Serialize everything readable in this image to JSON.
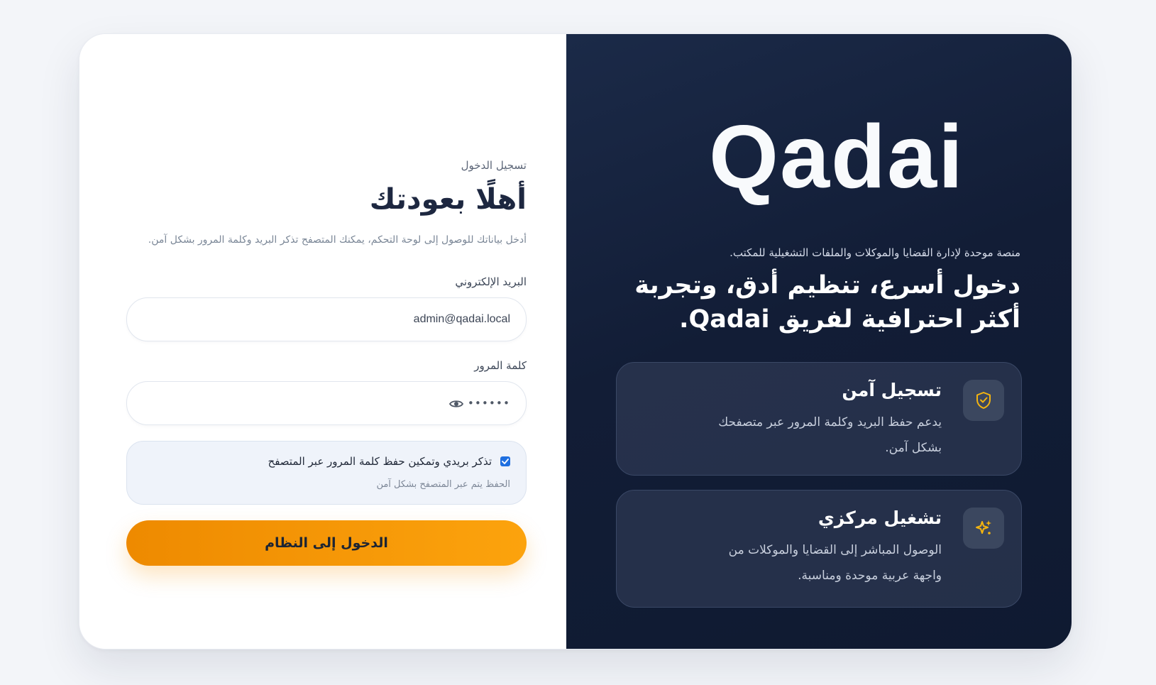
{
  "login": {
    "eyebrow": "تسجيل الدخول",
    "headline": "أهلًا بعودتك",
    "subline": "أدخل بياناتك للوصول إلى لوحة التحكم، يمكنك المتصفح تذكر البريد وكلمة المرور بشكل آمن.",
    "email_label": "البريد الإلكتروني",
    "email_value": "admin@qadai.local",
    "password_label": "كلمة المرور",
    "password_mask": "••••••",
    "remember_checked": true,
    "remember_label": "تذكر بريدي وتمكين حفظ كلمة المرور عبر المتصفح",
    "remember_hint": "الحفظ يتم عبر المتصفح بشكل آمن",
    "submit_label": "الدخول إلى النظام"
  },
  "brand": {
    "logo": "Qadai",
    "tagline": "منصة موحدة لإدارة القضايا والموكلات والملفات التشغيلية للمكتب.",
    "headline": "دخول أسرع، تنظيم أدق، وتجربة أكثر احترافية لفريق Qadai.",
    "features": [
      {
        "icon": "shield-check-icon",
        "title": "تسجيل آمن",
        "description": "يدعم حفظ البريد وكلمة المرور عبر متصفحك بشكل آمن."
      },
      {
        "icon": "sparkles-icon",
        "title": "تشغيل مركزي",
        "description": "الوصول المباشر إلى القضايا والموكلات من واجهة عربية موحدة ومناسبة."
      }
    ]
  },
  "colors": {
    "accent": "#f9980b",
    "panel_dark": "#121d36",
    "icon_gold": "#f5b50f",
    "checkbox_blue": "#1f6fe0"
  }
}
